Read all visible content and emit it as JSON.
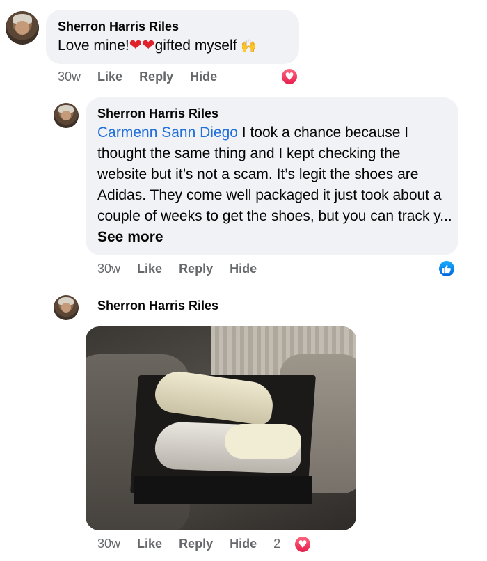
{
  "comments": [
    {
      "author": "Sherron Harris Riles",
      "text": "Love mine!",
      "text_after": "gifted myself",
      "emoji_heart": "❤",
      "emoji_hands": "🙌",
      "time": "30w",
      "like": "Like",
      "reply": "Reply",
      "hide": "Hide",
      "reaction": "love"
    },
    {
      "author": "Sherron Harris Riles",
      "mention": "Carmenn Sann Diego",
      "text": " I took a chance because I thought the same thing and I kept checking the website but it’s not a scam. It’s legit the shoes are Adidas. They come well packaged it just took about a couple of weeks to get the shoes, but you can track y...",
      "see_more": "See more",
      "time": "30w",
      "like": "Like",
      "reply": "Reply",
      "hide": "Hide",
      "reaction": "like"
    },
    {
      "author": "Sherron Harris Riles",
      "time": "30w",
      "like": "Like",
      "reply": "Reply",
      "hide": "Hide",
      "reaction_count": "2",
      "reaction": "love"
    }
  ],
  "colors": {
    "bubble": "#f0f2f5",
    "mention": "#216fdb",
    "meta": "#65676b",
    "love": "#e61e4d",
    "like": "#0062df"
  }
}
